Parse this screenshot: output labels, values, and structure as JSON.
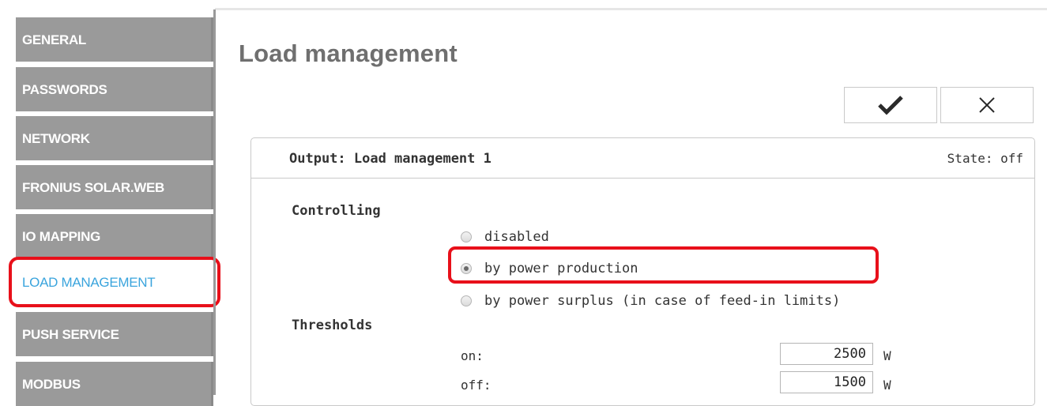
{
  "sidebar": {
    "items": [
      {
        "label": "GENERAL"
      },
      {
        "label": "PASSWORDS"
      },
      {
        "label": "NETWORK"
      },
      {
        "label": "FRONIUS SOLAR.WEB"
      },
      {
        "label": "IO MAPPING"
      },
      {
        "label": "LOAD MANAGEMENT",
        "active": true
      },
      {
        "label": "PUSH SERVICE"
      },
      {
        "label": "MODBUS"
      }
    ]
  },
  "page": {
    "title": "Load management"
  },
  "actions": {
    "confirm_icon": "checkmark-icon",
    "cancel_icon": "close-icon"
  },
  "panel": {
    "title": "Output: Load management 1",
    "state": "State: off",
    "controlling_label": "Controlling",
    "options": [
      {
        "label": "disabled",
        "checked": false
      },
      {
        "label": "by power production",
        "checked": true
      },
      {
        "label": "by power surplus (in case of feed-in limits)",
        "checked": false
      }
    ],
    "thresholds_label": "Thresholds",
    "thresholds": [
      {
        "label": "on:",
        "value": "2500",
        "unit": "W"
      },
      {
        "label": "off:",
        "value": "1500",
        "unit": "W"
      }
    ]
  },
  "colors": {
    "sidebar_bg": "#9a9a9a",
    "active_text": "#3aa4dd",
    "highlight_red": "#e8101a"
  }
}
